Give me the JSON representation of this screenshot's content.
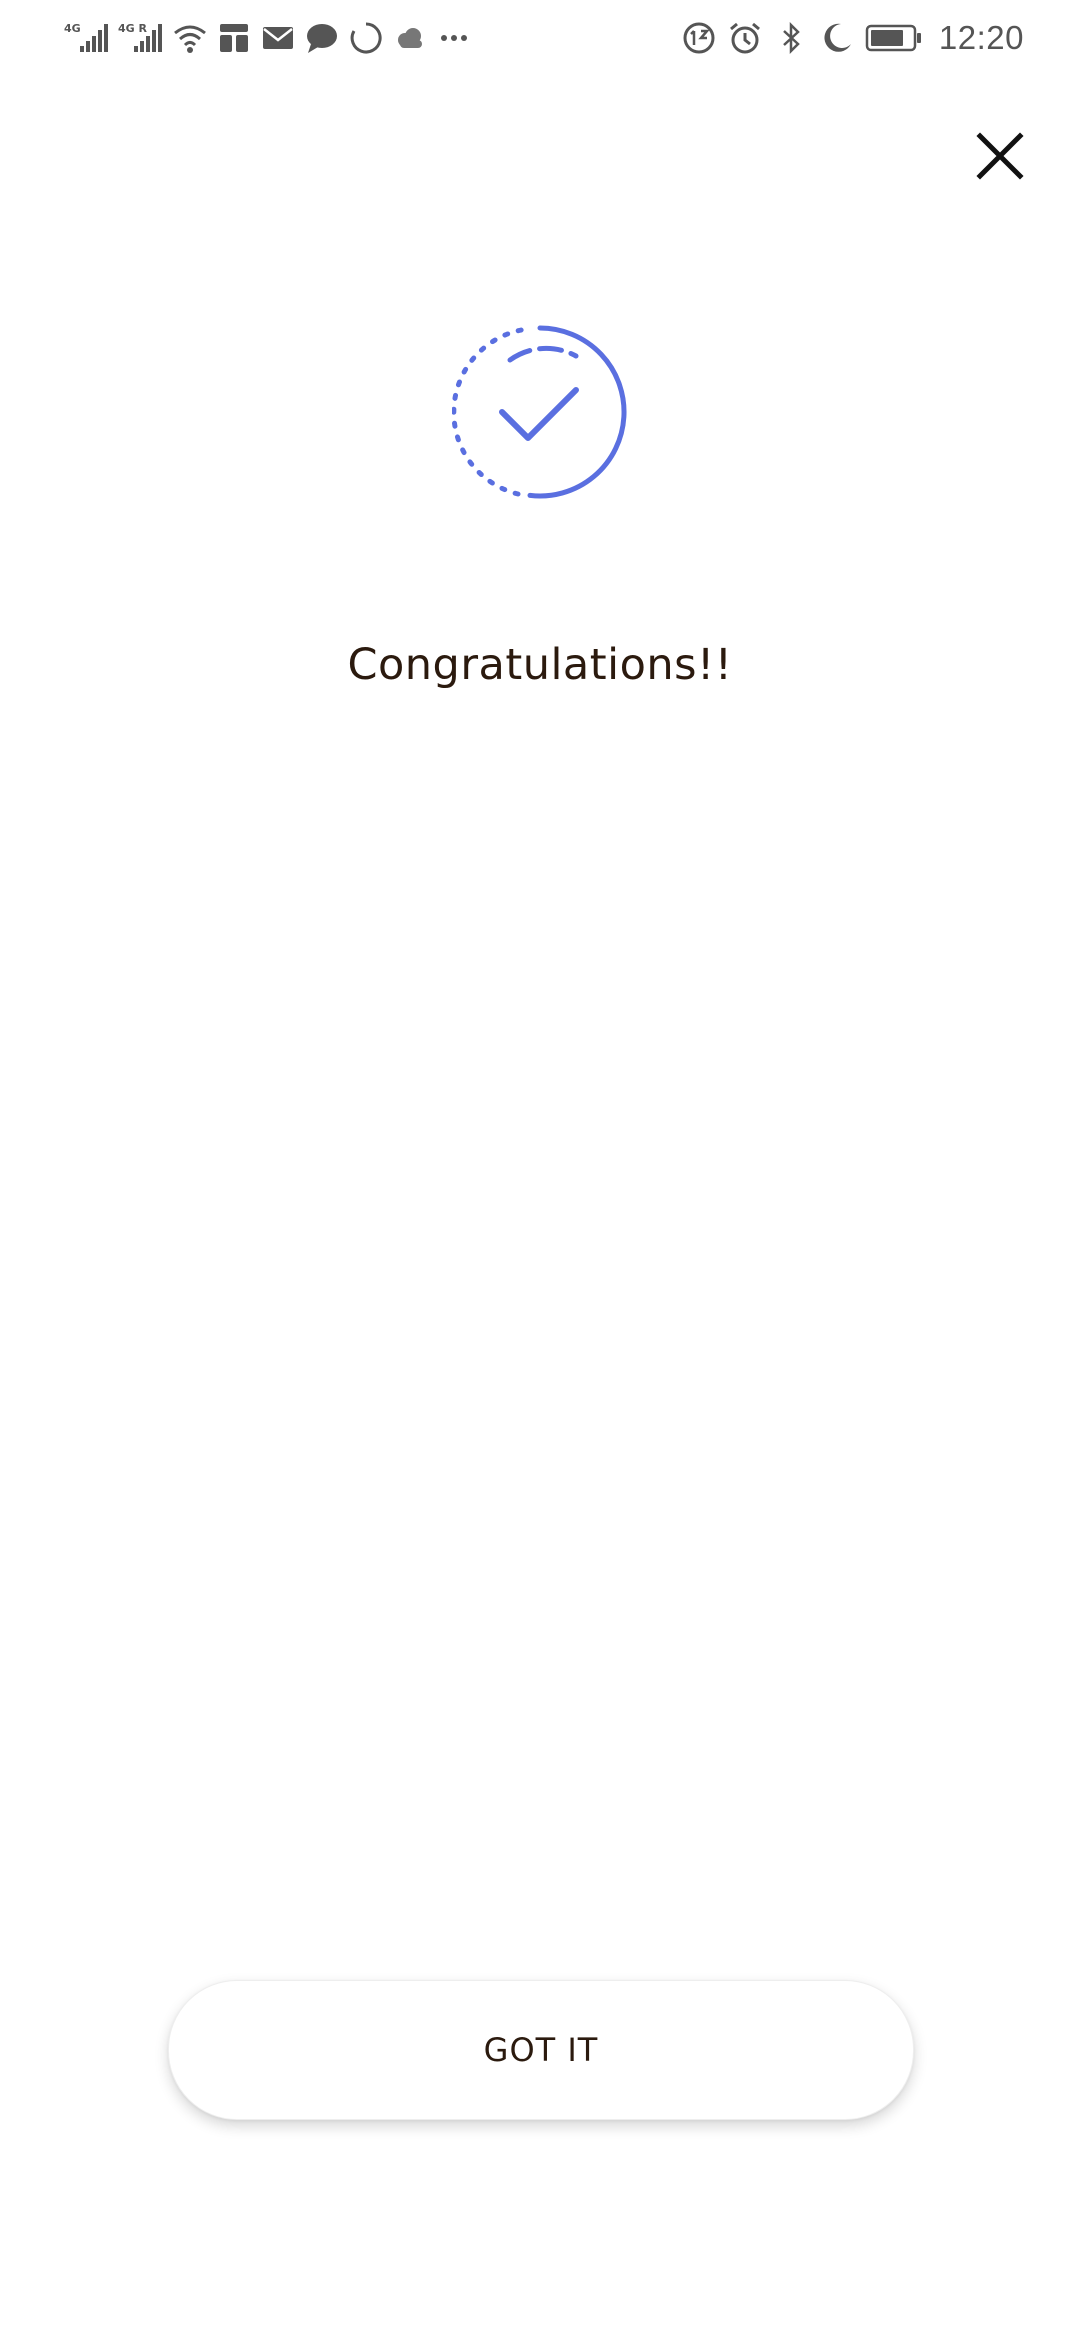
{
  "status_bar": {
    "time": "12:20",
    "left_icons": [
      "signal-4g-icon",
      "signal-4g-roaming-icon",
      "wifi-icon",
      "app-notification-icon",
      "mail-icon",
      "chat-icon",
      "sync-icon",
      "cloud-icon",
      "more-notifications-icon"
    ],
    "right_icons": [
      "data-saver-icon",
      "alarm-icon",
      "bluetooth-icon",
      "do-not-disturb-icon",
      "battery-icon"
    ]
  },
  "dialog": {
    "close_icon": "close-icon",
    "success_icon": "check-circle-icon",
    "title": "Congratulations!!",
    "got_it_label": "GOT IT"
  },
  "colors": {
    "accent": "#5a6fe0",
    "text": "#2b1a0e",
    "status_icon": "#555555",
    "background": "#ffffff"
  }
}
